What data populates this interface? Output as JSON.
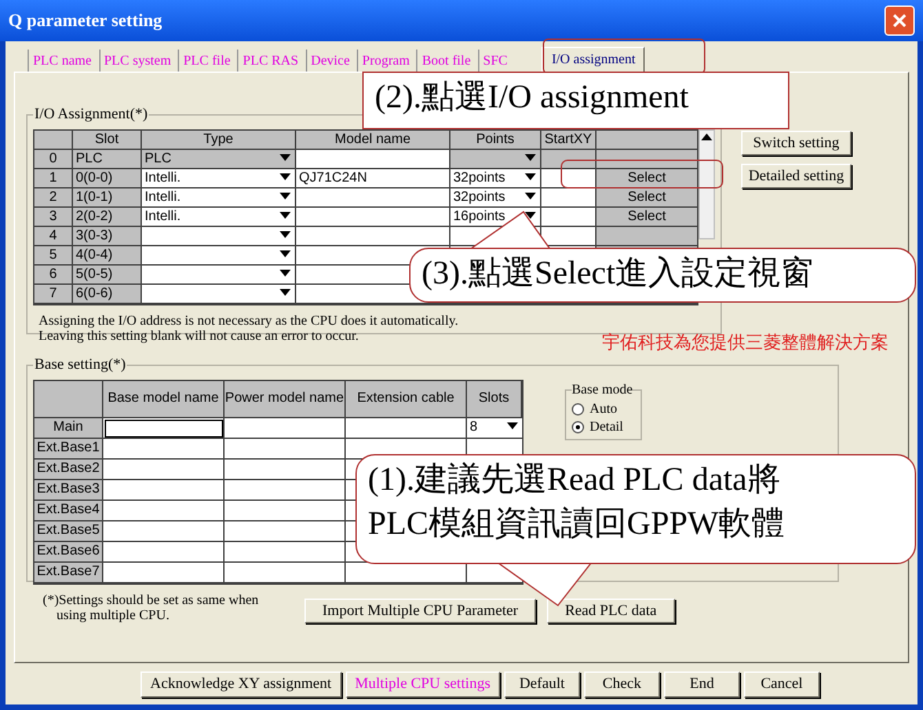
{
  "window": {
    "title": "Q parameter setting"
  },
  "tabs": [
    {
      "label": "PLC name",
      "selected": false
    },
    {
      "label": "PLC system",
      "selected": false
    },
    {
      "label": "PLC file",
      "selected": false
    },
    {
      "label": "PLC RAS",
      "selected": false
    },
    {
      "label": "Device",
      "selected": false
    },
    {
      "label": "Program",
      "selected": false
    },
    {
      "label": "Boot file",
      "selected": false
    },
    {
      "label": "SFC",
      "selected": false
    },
    {
      "label": "I/O assignment",
      "selected": true
    }
  ],
  "io_assignment": {
    "title": "I/O Assignment(*)",
    "columns": [
      "Slot",
      "Type",
      "Model name",
      "Points",
      "StartXY"
    ],
    "rows": [
      {
        "number": "0",
        "slot": "PLC",
        "type": "PLC",
        "kind": "cpu"
      },
      {
        "number": "1",
        "slot": "0(0-0)",
        "type": "Intelli.",
        "model_name": "QJ71C24N",
        "points": "32points",
        "select": "Select",
        "kind": "module"
      },
      {
        "number": "2",
        "slot": "1(0-1)",
        "type": "Intelli.",
        "points": "32points",
        "select": "Select",
        "kind": "module"
      },
      {
        "number": "3",
        "slot": "2(0-2)",
        "type": "Intelli.",
        "points": "16points",
        "select": "Select",
        "kind": "module"
      },
      {
        "number": "4",
        "slot": "3(0-3)",
        "kind": "empty"
      },
      {
        "number": "5",
        "slot": "4(0-4)",
        "kind": "empty"
      },
      {
        "number": "6",
        "slot": "5(0-5)",
        "kind": "empty"
      },
      {
        "number": "7",
        "slot": "6(0-6)",
        "kind": "empty"
      }
    ],
    "note": [
      "Assigning the I/O address is not necessary as the CPU does it automatically.",
      "Leaving this setting blank will not cause an error to occur."
    ]
  },
  "side_buttons": [
    "Switch setting",
    "Detailed setting"
  ],
  "promo_text": "宇佑科技為您提供三菱整體解決方案",
  "base_setting": {
    "title": "Base setting(*)",
    "columns": [
      "Base model name",
      "Power model name",
      "Extension cable",
      "Slots"
    ],
    "rows": [
      {
        "label": "Main",
        "slots": "8"
      },
      {
        "label": "Ext.Base1"
      },
      {
        "label": "Ext.Base2"
      },
      {
        "label": "Ext.Base3"
      },
      {
        "label": "Ext.Base4"
      },
      {
        "label": "Ext.Base5"
      },
      {
        "label": "Ext.Base6"
      },
      {
        "label": "Ext.Base7"
      }
    ]
  },
  "base_mode": {
    "title": "Base mode",
    "options": [
      {
        "label": "Auto",
        "selected": false
      },
      {
        "label": "Detail",
        "selected": true
      }
    ]
  },
  "footnote": [
    "(*)Settings should be set as same when",
    "using multiple CPU."
  ],
  "action_buttons": [
    "Import Multiple CPU Parameter",
    "Read PLC data"
  ],
  "bottom_buttons": [
    {
      "label": "Acknowledge XY assignment",
      "highlighted": false
    },
    {
      "label": "Multiple CPU settings",
      "highlighted": true
    },
    {
      "label": "Default",
      "highlighted": false
    },
    {
      "label": "Check",
      "highlighted": false
    },
    {
      "label": "End",
      "highlighted": false
    },
    {
      "label": "Cancel",
      "highlighted": false
    }
  ],
  "callouts": [
    {
      "lines": [
        "(2).點選I/O assignment"
      ]
    },
    {
      "lines": [
        "(3).點選Select進入設定視窗"
      ]
    },
    {
      "lines": [
        "(1).建議先選Read PLC data將",
        "PLC模組資訊讀回GPPW軟體"
      ]
    }
  ]
}
